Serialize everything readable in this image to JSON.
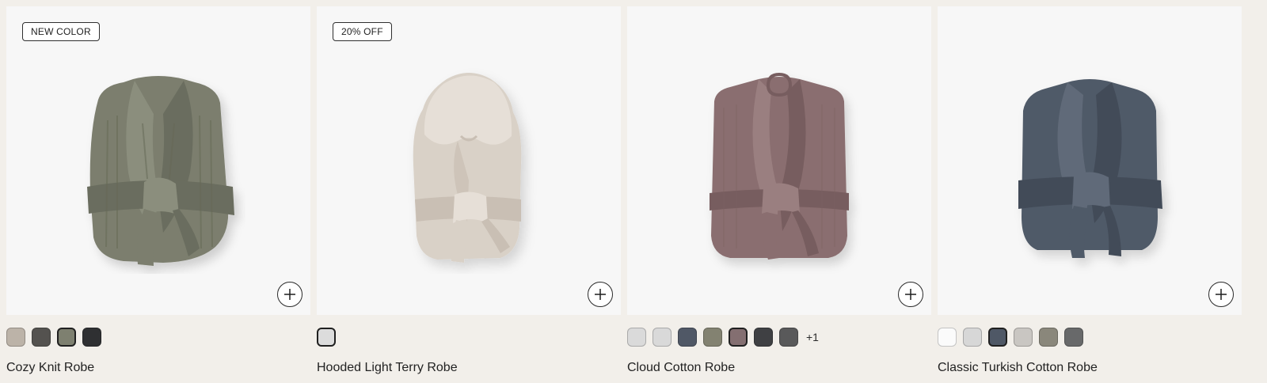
{
  "products": [
    {
      "name": "Cozy Knit Robe",
      "badge": "NEW COLOR",
      "image_color": "#7b7e6e",
      "image_shade": "#6a6d5e",
      "image_light": "#8b8e7d",
      "style": "shawl-knit",
      "swatches": [
        {
          "color": "#bcb3a8",
          "selected": false
        },
        {
          "color": "#54524f",
          "selected": false
        },
        {
          "color": "#7e8070",
          "selected": true
        },
        {
          "color": "#2f3032",
          "selected": false
        }
      ],
      "more_colors": ""
    },
    {
      "name": "Hooded Light Terry Robe",
      "badge": "20% OFF",
      "image_color": "#d9d1c7",
      "image_shade": "#c9bfb4",
      "image_light": "#e6dfd7",
      "style": "hooded",
      "swatches": [
        {
          "color": "#dcdcdc",
          "selected": true
        }
      ],
      "more_colors": ""
    },
    {
      "name": "Cloud Cotton Robe",
      "badge": "",
      "image_color": "#8a6e6f",
      "image_shade": "#775d5e",
      "image_light": "#9a7f80",
      "style": "kimono",
      "swatches": [
        {
          "color": "#dadada",
          "selected": false
        },
        {
          "color": "#d9d9d9",
          "selected": false
        },
        {
          "color": "#505866",
          "selected": false
        },
        {
          "color": "#838271",
          "selected": false
        },
        {
          "color": "#846f71",
          "selected": true
        },
        {
          "color": "#3f4043",
          "selected": false
        },
        {
          "color": "#59595a",
          "selected": false
        }
      ],
      "more_colors": "+1"
    },
    {
      "name": "Classic Turkish Cotton Robe",
      "badge": "",
      "image_color": "#505a68",
      "image_shade": "#434c59",
      "image_light": "#616b79",
      "style": "shawl-terry",
      "swatches": [
        {
          "color": "#fbfbfb",
          "selected": false
        },
        {
          "color": "#d7d7d7",
          "selected": false
        },
        {
          "color": "#4f5866",
          "selected": true
        },
        {
          "color": "#c9c6c2",
          "selected": false
        },
        {
          "color": "#8a877b",
          "selected": false
        },
        {
          "color": "#68696a",
          "selected": false
        }
      ],
      "more_colors": ""
    }
  ]
}
